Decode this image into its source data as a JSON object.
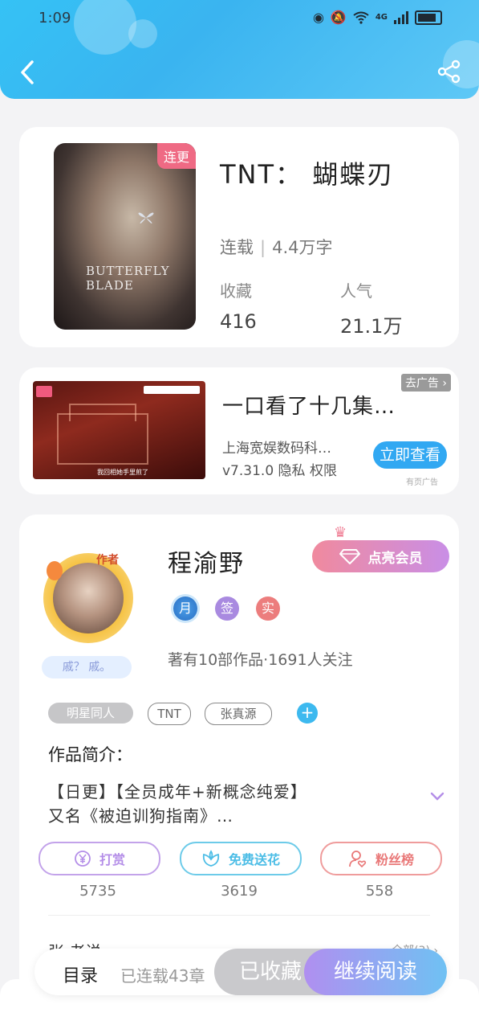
{
  "status_bar": {
    "time": "1:09",
    "network": "4G"
  },
  "colors": {
    "header_blue": "#35c2f5",
    "cover_tag_pink": "#ef6a84",
    "cta_blue": "#31a8f2",
    "vip_pink": "#f08a9e"
  },
  "book": {
    "cover_tag": "连更",
    "cover_title": "BUTTERFLY BLADE",
    "title": "TNT： 蝴蝶刃",
    "status": "连载",
    "word_count": "4.4万字",
    "favorites_label": "收藏",
    "favorites_value": "416",
    "popularity_label": "人气",
    "popularity_value": "21.1万"
  },
  "ad": {
    "close_label": "去广告",
    "title": "一口看了十几集…",
    "company": "上海宽娱数码科…",
    "meta": "v7.31.0 隐私 权限",
    "cta": "立即查看",
    "source": "有页广告",
    "caption": "我回相她手里煎了"
  },
  "author": {
    "tag": "作者",
    "motto": "戚？ 戚。",
    "name": "程渝野",
    "vip_label": "点亮会员",
    "badges": [
      "月",
      "签",
      "实"
    ],
    "bio": "著有10部作品·1691人关注",
    "tags": [
      "明星同人",
      "TNT",
      "张真源"
    ]
  },
  "intro": {
    "heading": "作品简介：",
    "line1": "【日更】【全员成年+新概念纯爱】",
    "line2": "又名《被迫训狗指南》…"
  },
  "actions": [
    {
      "label": "打赏",
      "count": "5735"
    },
    {
      "label": "免费送花",
      "count": "3619"
    },
    {
      "label": "粉丝榜",
      "count": "558"
    }
  ],
  "peek": {
    "left": "张 老说",
    "right": "全部(3)"
  },
  "bottom_bar": {
    "toc": "目录",
    "toc_sub": "已连载43章",
    "favorite": "已收藏",
    "read": "继续阅读"
  }
}
